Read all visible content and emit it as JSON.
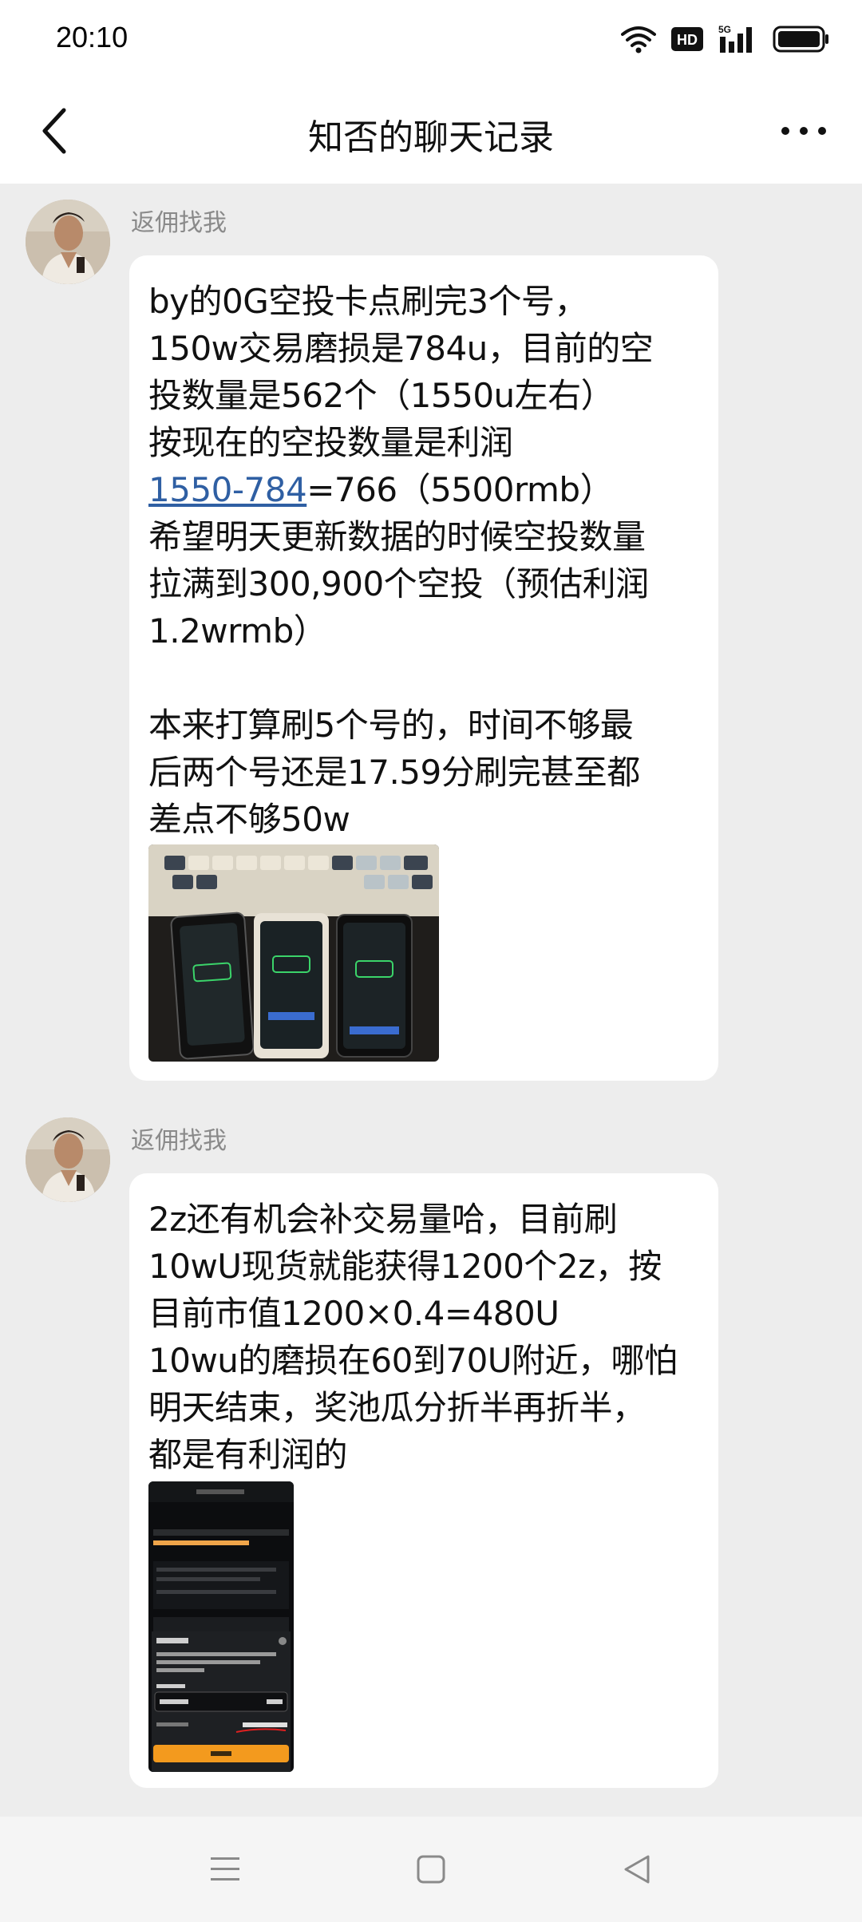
{
  "status": {
    "time": "20:10",
    "icons": [
      "wifi-icon",
      "hd-icon",
      "signal-5g-icon",
      "battery-icon"
    ],
    "hd_label": "HD",
    "net_label": "5G"
  },
  "nav": {
    "title": "知否的聊天记录",
    "back_icon": "chevron-left-icon",
    "more_icon": "more-horizontal-icon"
  },
  "messages": [
    {
      "sender": "返佣找我",
      "text_before_link": "by的0G空投卡点刷完3个号，\n150w交易磨损是784u，目前的空\n投数量是562个（1550u左右）\n按现在的空投数量是利润\n",
      "link": "1550-784",
      "text_after_link": "=766（5500rmb）\n希望明天更新数据的时候空投数量\n拉满到300,900个空投（预估利润\n1.2wrmb）\n\n本来打算刷5个号的，时间不够最\n后两个号还是17.59分刷完甚至都\n差点不够50w",
      "image": "photo-three-phones-on-keyboard"
    },
    {
      "sender": "返佣找我",
      "text": "2z还有机会补交易量哈，目前刷\n10wU现货就能获得1200个2z，按\n目前市值1200×0.4=480U\n10wu的磨损在60到70U附近，哪怕\n明天结束，奖池瓜分折半再折半，\n都是有利润的",
      "image": "screenshot-reward-calculator"
    }
  ],
  "system_nav": {
    "icons": [
      "menu-icon",
      "home-square-icon",
      "back-triangle-icon"
    ]
  },
  "colors": {
    "background": "#ededed",
    "bubble": "#ffffff",
    "link": "#2f5fa3",
    "sender": "#8a8a8a"
  }
}
